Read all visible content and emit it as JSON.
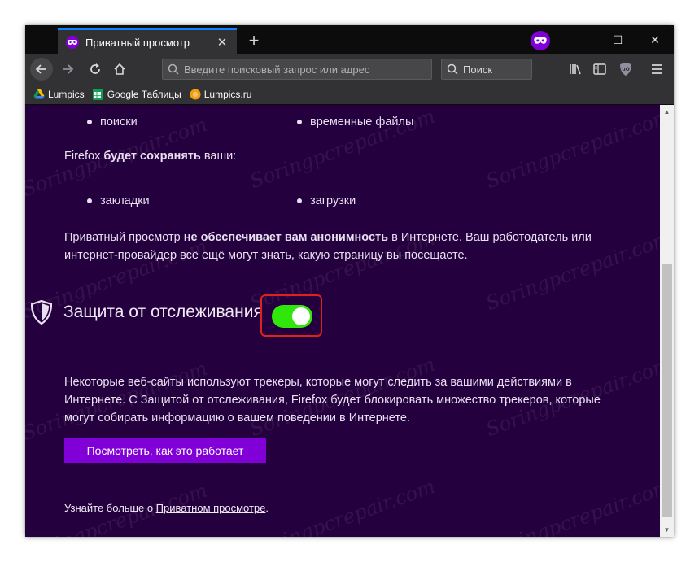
{
  "browser": {
    "tab_title": "Приватный просмотр",
    "url_placeholder": "Введите поисковый запрос или адрес",
    "search_placeholder": "Поиск"
  },
  "bookmarks": [
    {
      "label": "Lumpics",
      "icon": "google-drive-icon"
    },
    {
      "label": "Google Таблицы",
      "icon": "google-sheets-icon"
    },
    {
      "label": "Lumpics.ru",
      "icon": "orange-circle-icon"
    }
  ],
  "content": {
    "not_saved_items": [
      "поиски",
      "временные файлы"
    ],
    "will_save_prefix": "Firefox ",
    "will_save_bold": "будет сохранять",
    "will_save_suffix": " ваши:",
    "saved_items": [
      "закладки",
      "загрузки"
    ],
    "anon_prefix": "Приватный просмотр ",
    "anon_bold": "не обеспечивает вам анонимность",
    "anon_line1_suffix": " в Интернете. Ваш работодатель или",
    "anon_line2": "интернет-провайдер всё ещё могут знать, какую страницу вы посещаете.",
    "tracking_heading": "Защита от отслеживания",
    "tracking_toggle_on": true,
    "tracking_desc_line1": "Некоторые веб-сайты используют трекеры, которые могут следить за вашими действиями в",
    "tracking_desc_line2": "Интернете. С Защитой от отслеживания, Firefox будет блокировать множество трекеров, которые",
    "tracking_desc_line3": "могут собирать информацию о вашем поведении в Интернете.",
    "cta_label": "Посмотреть, как это работает",
    "learn_prefix": "Узнайте больше о ",
    "learn_link": "Приватном просмотре",
    "learn_suffix": "."
  },
  "watermark": "Soringpcrepair.com",
  "colors": {
    "page_bg": "#25003e",
    "accent": "#8000d7",
    "toggle_on": "#30e60b",
    "highlight": "#e01f1f"
  }
}
